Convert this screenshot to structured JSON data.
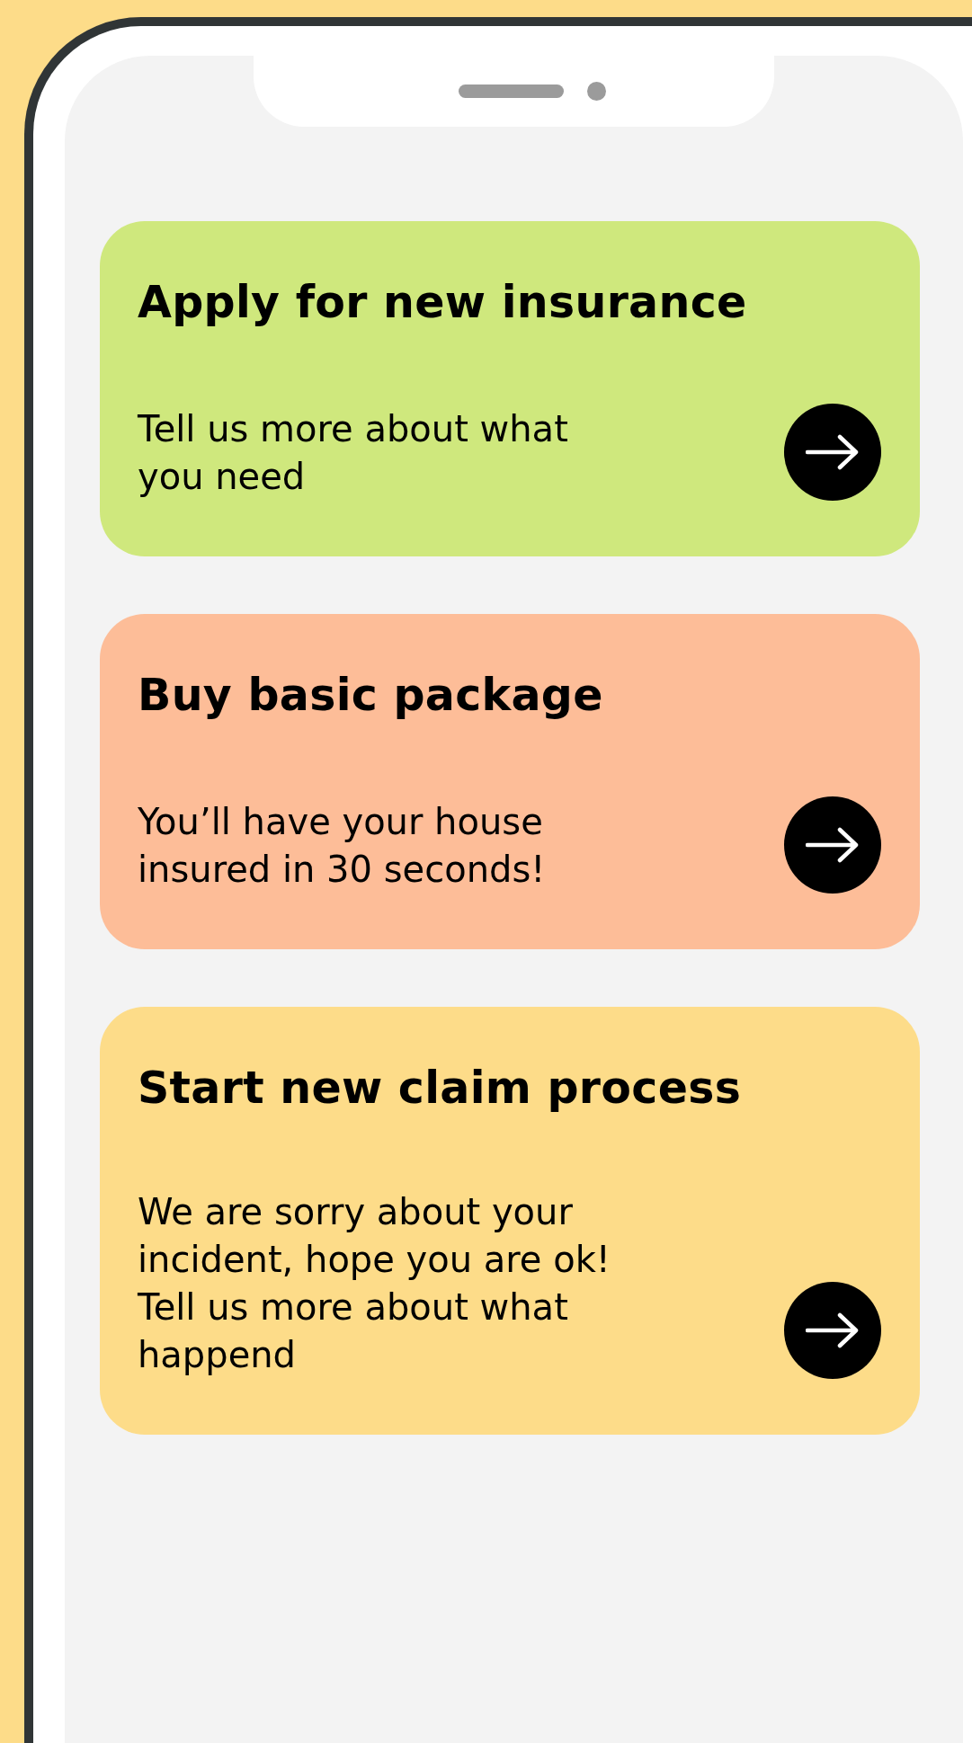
{
  "cards": [
    {
      "title": "Apply for new insurance",
      "text": "Tell us more about what you need",
      "color": "#cfe87d"
    },
    {
      "title": "Buy basic package",
      "text": "You’ll have your house insured in 30 seconds!",
      "color": "#fdbd98"
    },
    {
      "title": "Start new claim process",
      "text": "We are sorry about your incident, hope you are ok! Tell us more about what happend",
      "color": "#fddc89"
    }
  ]
}
